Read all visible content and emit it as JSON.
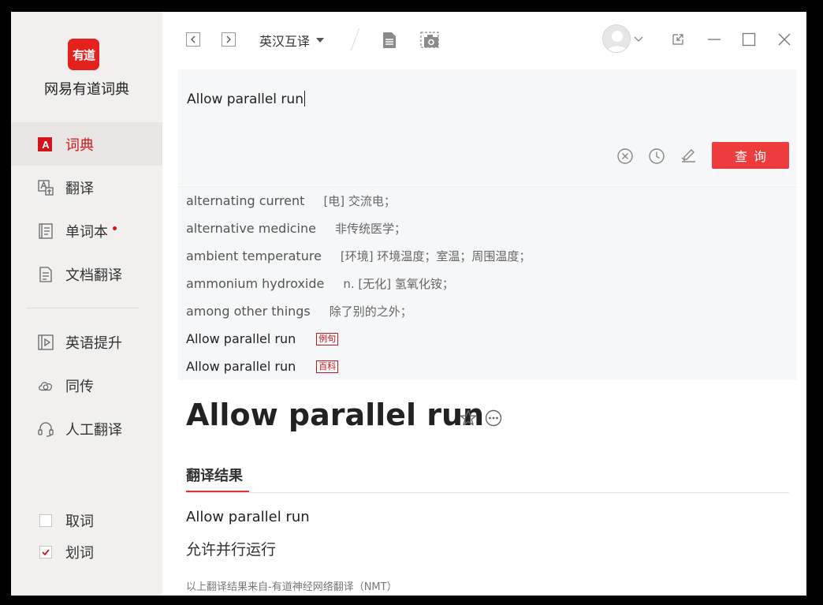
{
  "app": {
    "logo_text": "有道",
    "title": "网易有道词典"
  },
  "sidebar": {
    "items": [
      {
        "label": "词典",
        "icon": "dictionary-icon",
        "active": true
      },
      {
        "label": "翻译",
        "icon": "translate-icon",
        "active": false
      },
      {
        "label": "单词本",
        "icon": "wordbook-icon",
        "active": false,
        "badge": true
      },
      {
        "label": "文档翻译",
        "icon": "document-icon",
        "active": false
      },
      {
        "label": "英语提升",
        "icon": "video-play-icon",
        "active": false
      },
      {
        "label": "同传",
        "icon": "cloud-icon",
        "active": false
      },
      {
        "label": "人工翻译",
        "icon": "headset-icon",
        "active": false
      }
    ],
    "checkboxes": [
      {
        "label": "取词",
        "checked": false
      },
      {
        "label": "划词",
        "checked": true
      }
    ]
  },
  "topbar": {
    "back_icon": "chevron-left-icon",
    "forward_icon": "chevron-right-icon",
    "mode_label": "英汉互译",
    "doc_icon": "document-icon",
    "screenshot_icon": "screenshot-camera-icon",
    "window_controls": [
      "restore-icon",
      "minimize-icon",
      "maximize-icon",
      "close-icon"
    ]
  },
  "search": {
    "value": "Allow parallel run",
    "query_label": "查询",
    "tools": [
      "clear-icon",
      "history-icon",
      "handwriting-icon"
    ]
  },
  "suggestions": [
    {
      "word": "alternating current",
      "definition": "[电] 交流电；"
    },
    {
      "word": "alternative medicine",
      "definition": "非传统医学；"
    },
    {
      "word": "ambient temperature",
      "definition": "[环境] 环境温度；室温；周围温度；"
    },
    {
      "word": "ammonium hydroxide",
      "definition": "n. [无化] 氢氧化铵；"
    },
    {
      "word": "among other things",
      "definition": "除了别的之外；"
    },
    {
      "word": "Allow parallel run",
      "tag": "例句"
    },
    {
      "word": "Allow parallel run",
      "tag": "百科"
    }
  ],
  "result": {
    "headword": "Allow parallel run",
    "section_title": "翻译结果",
    "source_text": "Allow parallel run",
    "translation": "允许并行运行",
    "note": "以上翻译结果来自-有道神经网络翻译（NMT）"
  },
  "colors": {
    "accent": "#e3343a",
    "query_button": "#ee3c3c",
    "sidebar_bg": "#f1f0ef"
  }
}
